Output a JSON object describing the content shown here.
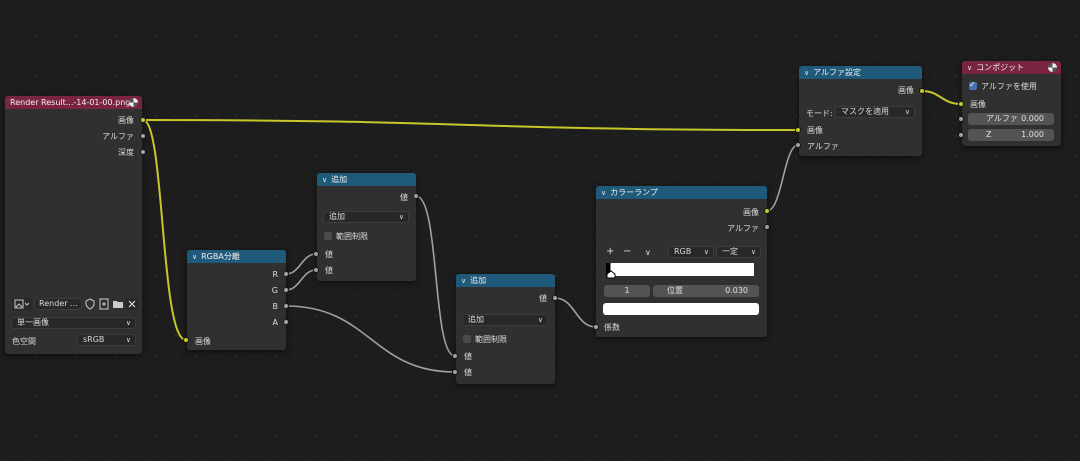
{
  "nodes": {
    "render_result": {
      "title": "Render Result...-14-01-00.png",
      "outputs": [
        "画像",
        "アルファ",
        "深度"
      ],
      "image_name": "Render ...",
      "source_select": "単一画像",
      "colorspace_label": "色空間",
      "colorspace_value": "sRGB",
      "input_label": "画像"
    },
    "separate_rgba": {
      "title": "RGBA分離",
      "outputs": [
        "R",
        "G",
        "B",
        "A"
      ],
      "input_label": "画像"
    },
    "add_top": {
      "title": "追加",
      "output_label": "値",
      "operation": "追加",
      "clamp_label": "範囲制限",
      "inputs": [
        "値",
        "値"
      ]
    },
    "add_bottom": {
      "title": "追加",
      "output_label": "値",
      "operation": "追加",
      "clamp_label": "範囲制限",
      "inputs": [
        "値",
        "値"
      ]
    },
    "color_ramp": {
      "title": "カラーランプ",
      "outputs": [
        "画像",
        "アルファ"
      ],
      "plus": "+",
      "minus": "−",
      "menu": "∨",
      "color_mode": "RGB",
      "interpolation": "一定",
      "stop_index": "1",
      "position_label": "位置",
      "position_value": "0.030",
      "input_label": "係数"
    },
    "set_alpha": {
      "title": "アルファ設定",
      "output_label": "画像",
      "mode_label": "モード:",
      "mode_value": "マスクを適用",
      "inputs": [
        "画像",
        "アルファ"
      ]
    },
    "composite": {
      "title": "コンポジット",
      "use_alpha_label": "アルファを使用",
      "input_label": "画像",
      "alpha_label": "アルファ",
      "alpha_value": "0.000",
      "z_label": "Z",
      "z_value": "1.000"
    }
  },
  "colors": {
    "image_link": "#c7c729",
    "value_link": "#a1a1a1",
    "header_blue": "#1f5a7a",
    "header_red": "#7a2540"
  }
}
